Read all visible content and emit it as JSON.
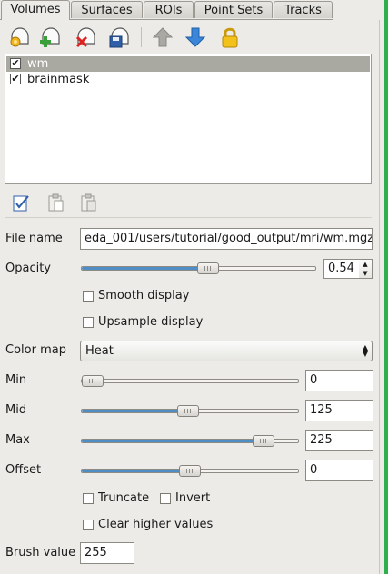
{
  "tabs": [
    "Volumes",
    "Surfaces",
    "ROIs",
    "Point Sets",
    "Tracks"
  ],
  "active_tab": "Volumes",
  "toolbar": {
    "icons": [
      "load-volume-icon",
      "new-volume-icon",
      "close-volume-icon",
      "save-volume-icon",
      "move-up-icon",
      "move-down-icon",
      "lock-icon"
    ]
  },
  "layers": [
    {
      "name": "wm",
      "checked": true,
      "selected": true
    },
    {
      "name": "brainmask",
      "checked": true,
      "selected": false
    }
  ],
  "list_tools": [
    "select-all-icon",
    "copy-icon",
    "paste-icon"
  ],
  "form": {
    "file_name_label": "File name",
    "file_name_value": "eda_001/users/tutorial/good_output/mri/wm.mgz",
    "opacity_label": "Opacity",
    "opacity_value": "0.54",
    "opacity_fraction": 0.54,
    "smooth_display_label": "Smooth display",
    "upsample_display_label": "Upsample display",
    "color_map_label": "Color map",
    "color_map_value": "Heat",
    "min_label": "Min",
    "min_value": "0",
    "min_fraction": 0.05,
    "mid_label": "Mid",
    "mid_value": "125",
    "mid_fraction": 0.49,
    "max_label": "Max",
    "max_value": "225",
    "max_fraction": 0.84,
    "offset_label": "Offset",
    "offset_value": "0",
    "offset_fraction": 0.5,
    "truncate_label": "Truncate",
    "invert_label": "Invert",
    "clear_higher_label": "Clear higher values",
    "brush_value_label": "Brush value",
    "brush_value": "255"
  },
  "colors": {
    "slider_fill": "#4f8dc5",
    "selection": "#a9a8a1",
    "edge_accent": "#2fae4e"
  }
}
